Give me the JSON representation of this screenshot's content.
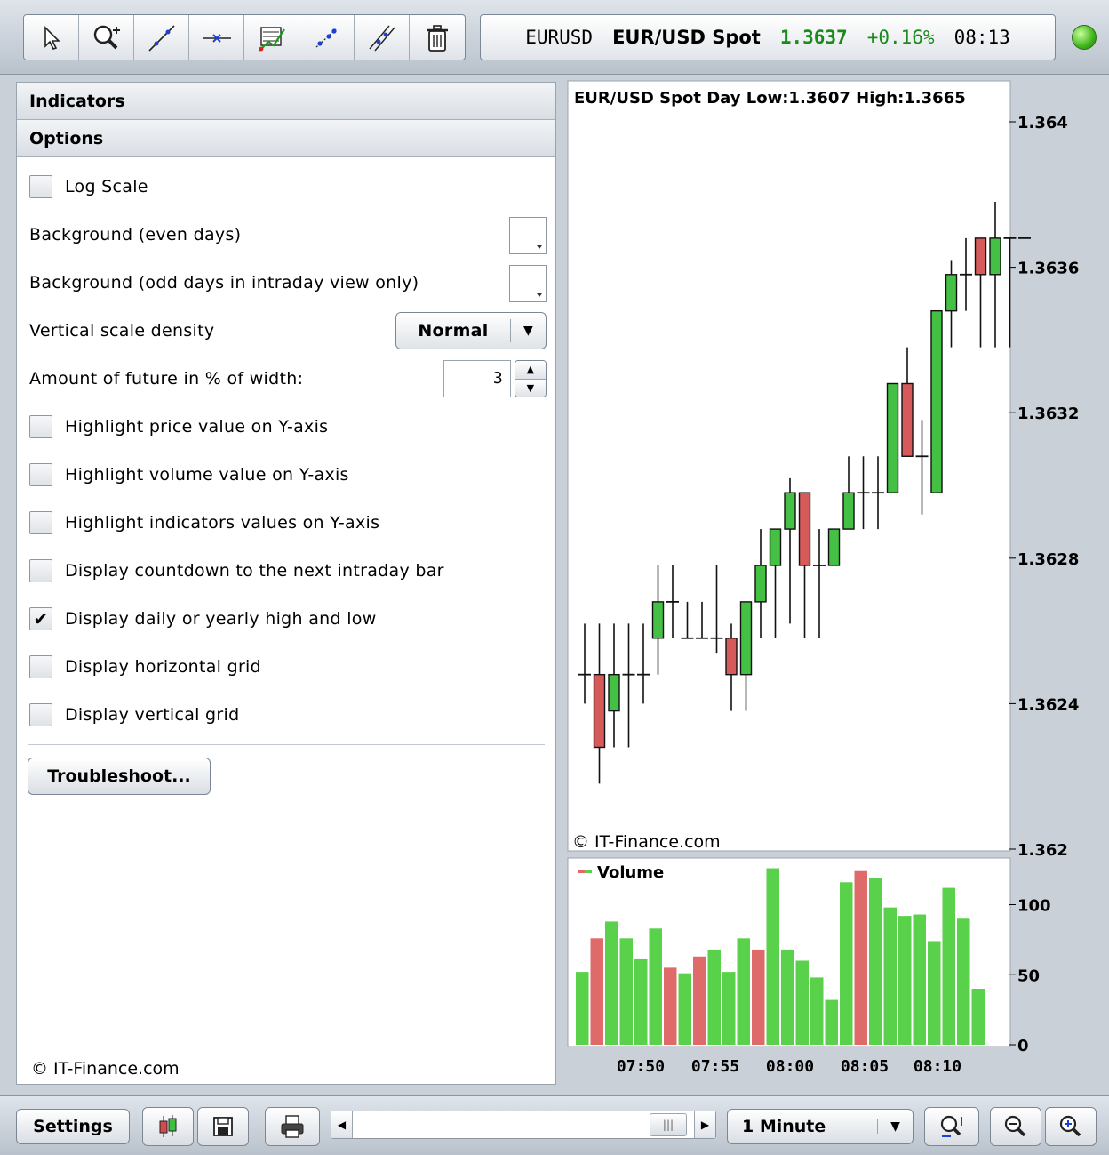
{
  "toolbar": {
    "tools": [
      "cursor-icon",
      "zoom-add-icon",
      "trendline-icon",
      "horizontal-line-icon",
      "fibonacci-icon",
      "channel-icon",
      "parallel-lines-icon",
      "trash-icon"
    ]
  },
  "ticker": {
    "symbol": "EURUSD",
    "name": "EUR/USD Spot",
    "price": "1.3637",
    "change": "+0.16%",
    "time": "08:13"
  },
  "panel": {
    "indicators_label": "Indicators",
    "options_label": "Options",
    "log_scale": "Log Scale",
    "bg_even": "Background (even days)",
    "bg_odd": "Background (odd days in intraday view only)",
    "vscale_label": "Vertical scale density",
    "vscale_value": "Normal",
    "future_label": "Amount of future in % of width:",
    "future_value": "3",
    "hl_price": "Highlight price value on Y-axis",
    "hl_volume": "Highlight volume value on Y-axis",
    "hl_indicators": "Highlight indicators values on Y-axis",
    "countdown": "Display countdown to the next intraday bar",
    "daily_hl": "Display daily or yearly high and low",
    "hgrid": "Display horizontal grid",
    "vgrid": "Display vertical grid",
    "troubleshoot": "Troubleshoot...",
    "copyright": "© IT-Finance.com",
    "checked": {
      "log_scale": false,
      "hl_price": false,
      "hl_volume": false,
      "hl_indicators": false,
      "countdown": false,
      "daily_hl": true,
      "hgrid": false,
      "vgrid": false
    }
  },
  "chart_data": {
    "type": "candlestick",
    "title": "EUR/USD Spot  Day  Low:1.3607  High:1.3665",
    "watermark": "© IT-Finance.com",
    "price_ticks": [
      "1.364",
      "1.3636",
      "1.3632",
      "1.3628",
      "1.3624",
      "1.362"
    ],
    "ylim": [
      1.362,
      1.364
    ],
    "candles": [
      {
        "o": 1.36248,
        "h": 1.36262,
        "l": 1.3624,
        "c": 1.36248
      },
      {
        "o": 1.36248,
        "h": 1.36262,
        "l": 1.36218,
        "c": 1.36228
      },
      {
        "o": 1.36238,
        "h": 1.36262,
        "l": 1.36228,
        "c": 1.36248
      },
      {
        "o": 1.36248,
        "h": 1.36262,
        "l": 1.36228,
        "c": 1.36248
      },
      {
        "o": 1.36248,
        "h": 1.36262,
        "l": 1.3624,
        "c": 1.36248
      },
      {
        "o": 1.36258,
        "h": 1.36278,
        "l": 1.36248,
        "c": 1.36268
      },
      {
        "o": 1.36268,
        "h": 1.36278,
        "l": 1.36258,
        "c": 1.36268
      },
      {
        "o": 1.36258,
        "h": 1.36268,
        "l": 1.36258,
        "c": 1.36258
      },
      {
        "o": 1.36258,
        "h": 1.36268,
        "l": 1.36258,
        "c": 1.36258
      },
      {
        "o": 1.36258,
        "h": 1.36278,
        "l": 1.36254,
        "c": 1.36258
      },
      {
        "o": 1.36258,
        "h": 1.36262,
        "l": 1.36238,
        "c": 1.36248
      },
      {
        "o": 1.36248,
        "h": 1.36268,
        "l": 1.36238,
        "c": 1.36268
      },
      {
        "o": 1.36268,
        "h": 1.36288,
        "l": 1.36258,
        "c": 1.36278
      },
      {
        "o": 1.36278,
        "h": 1.36288,
        "l": 1.36258,
        "c": 1.36288
      },
      {
        "o": 1.36288,
        "h": 1.36302,
        "l": 1.36262,
        "c": 1.36298
      },
      {
        "o": 1.36298,
        "h": 1.36298,
        "l": 1.36258,
        "c": 1.36278
      },
      {
        "o": 1.36278,
        "h": 1.36288,
        "l": 1.36258,
        "c": 1.36278
      },
      {
        "o": 1.36278,
        "h": 1.36288,
        "l": 1.36278,
        "c": 1.36288
      },
      {
        "o": 1.36288,
        "h": 1.36308,
        "l": 1.36288,
        "c": 1.36298
      },
      {
        "o": 1.36298,
        "h": 1.36308,
        "l": 1.36288,
        "c": 1.36298
      },
      {
        "o": 1.36298,
        "h": 1.36308,
        "l": 1.36288,
        "c": 1.36298
      },
      {
        "o": 1.36298,
        "h": 1.36328,
        "l": 1.36298,
        "c": 1.36328
      },
      {
        "o": 1.36328,
        "h": 1.36338,
        "l": 1.36308,
        "c": 1.36308
      },
      {
        "o": 1.36308,
        "h": 1.36318,
        "l": 1.36292,
        "c": 1.36308
      },
      {
        "o": 1.36298,
        "h": 1.36348,
        "l": 1.36298,
        "c": 1.36348
      },
      {
        "o": 1.36348,
        "h": 1.36362,
        "l": 1.36338,
        "c": 1.36358
      },
      {
        "o": 1.36358,
        "h": 1.36368,
        "l": 1.36348,
        "c": 1.36358
      },
      {
        "o": 1.36368,
        "h": 1.36368,
        "l": 1.36338,
        "c": 1.36358
      },
      {
        "o": 1.36358,
        "h": 1.36378,
        "l": 1.36338,
        "c": 1.36368
      },
      {
        "o": 1.36368,
        "h": 1.36368,
        "l": 1.36338,
        "c": 1.36368
      },
      {
        "o": 1.36368,
        "h": 1.36368,
        "l": 1.36368,
        "c": 1.36368
      }
    ],
    "volume_label": "Volume",
    "volume_ticks": [
      "100",
      "50",
      "0"
    ],
    "volume": [
      {
        "v": 52,
        "up": true
      },
      {
        "v": 76,
        "up": false
      },
      {
        "v": 88,
        "up": true
      },
      {
        "v": 76,
        "up": true
      },
      {
        "v": 61,
        "up": true
      },
      {
        "v": 83,
        "up": true
      },
      {
        "v": 55,
        "up": false
      },
      {
        "v": 51,
        "up": true
      },
      {
        "v": 63,
        "up": false
      },
      {
        "v": 68,
        "up": true
      },
      {
        "v": 52,
        "up": true
      },
      {
        "v": 76,
        "up": true
      },
      {
        "v": 68,
        "up": false
      },
      {
        "v": 126,
        "up": true
      },
      {
        "v": 68,
        "up": true
      },
      {
        "v": 60,
        "up": true
      },
      {
        "v": 48,
        "up": true
      },
      {
        "v": 32,
        "up": true
      },
      {
        "v": 116,
        "up": true
      },
      {
        "v": 124,
        "up": false
      },
      {
        "v": 119,
        "up": true
      },
      {
        "v": 98,
        "up": true
      },
      {
        "v": 92,
        "up": true
      },
      {
        "v": 93,
        "up": true
      },
      {
        "v": 74,
        "up": true
      },
      {
        "v": 112,
        "up": true
      },
      {
        "v": 90,
        "up": true
      },
      {
        "v": 40,
        "up": true
      }
    ],
    "time_ticks": [
      "07:50",
      "07:55",
      "08:00",
      "08:05",
      "08:10"
    ]
  },
  "bottom": {
    "settings": "Settings",
    "interval": "1 Minute"
  }
}
